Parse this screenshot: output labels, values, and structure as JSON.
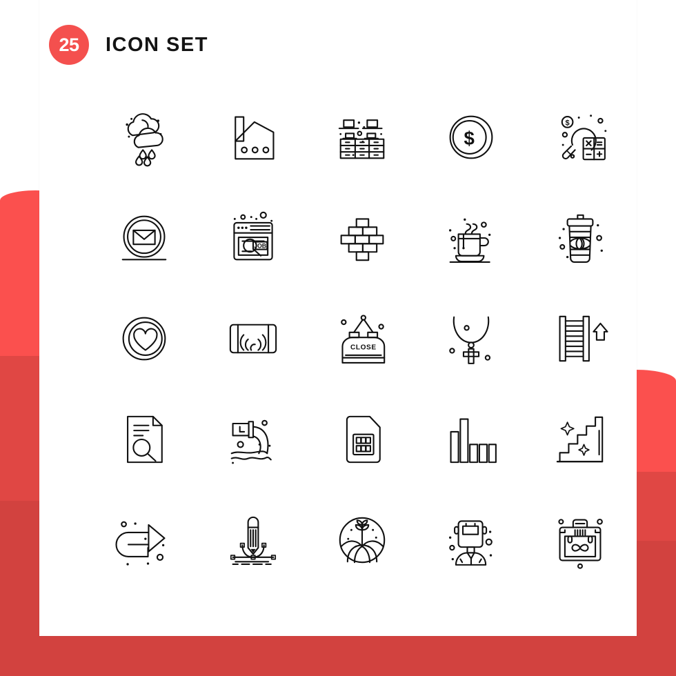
{
  "header": {
    "count": "25",
    "title": "Icon Set"
  },
  "colors": {
    "badge": "#f4504e",
    "red_light": "#fb504e",
    "red_mid": "#e04744",
    "red_dark": "#d2423f",
    "stroke": "#111111",
    "card": "#ffffff"
  },
  "canvas": {
    "width": "980",
    "height": "980"
  },
  "grid": {
    "columns": "5",
    "rows": "5",
    "total": "25"
  },
  "icons": [
    {
      "name": "rain-cloud-icon",
      "label": "Rain Cloud"
    },
    {
      "name": "factory-icon",
      "label": "Factory"
    },
    {
      "name": "office-desk-icon",
      "label": "Office Desk"
    },
    {
      "name": "dollar-coin-icon",
      "label": "Dollar Coin"
    },
    {
      "name": "budget-calculator-icon",
      "label": "Budget Calculator"
    },
    {
      "name": "email-circle-icon",
      "label": "Email"
    },
    {
      "name": "job-search-icon",
      "label": "Job Search",
      "text": "JOB"
    },
    {
      "name": "brick-wall-icon",
      "label": "Brick Wall"
    },
    {
      "name": "coffee-cup-icon",
      "label": "Hot Coffee"
    },
    {
      "name": "takeaway-coffee-icon",
      "label": "Takeaway Coffee"
    },
    {
      "name": "heart-circle-icon",
      "label": "Favorite"
    },
    {
      "name": "speaker-icon",
      "label": "Speaker"
    },
    {
      "name": "close-sign-icon",
      "label": "Close Sign",
      "text": "CLOSE"
    },
    {
      "name": "necklace-icon",
      "label": "Necklace"
    },
    {
      "name": "escalator-icon",
      "label": "Escalator Up"
    },
    {
      "name": "document-search-icon",
      "label": "Document Search"
    },
    {
      "name": "water-pollution-icon",
      "label": "Water Pollution"
    },
    {
      "name": "sim-card-icon",
      "label": "Sim Card"
    },
    {
      "name": "bar-chart-icon",
      "label": "Bar Chart"
    },
    {
      "name": "stairs-sparkle-icon",
      "label": "Clean Stairs"
    },
    {
      "name": "redo-arrow-icon",
      "label": "Redo"
    },
    {
      "name": "pencil-curve-icon",
      "label": "Pencil Curve"
    },
    {
      "name": "agriculture-icon",
      "label": "Agriculture"
    },
    {
      "name": "welder-icon",
      "label": "Welder"
    },
    {
      "name": "mustache-briefcase-icon",
      "label": "Mustache Briefcase"
    }
  ]
}
